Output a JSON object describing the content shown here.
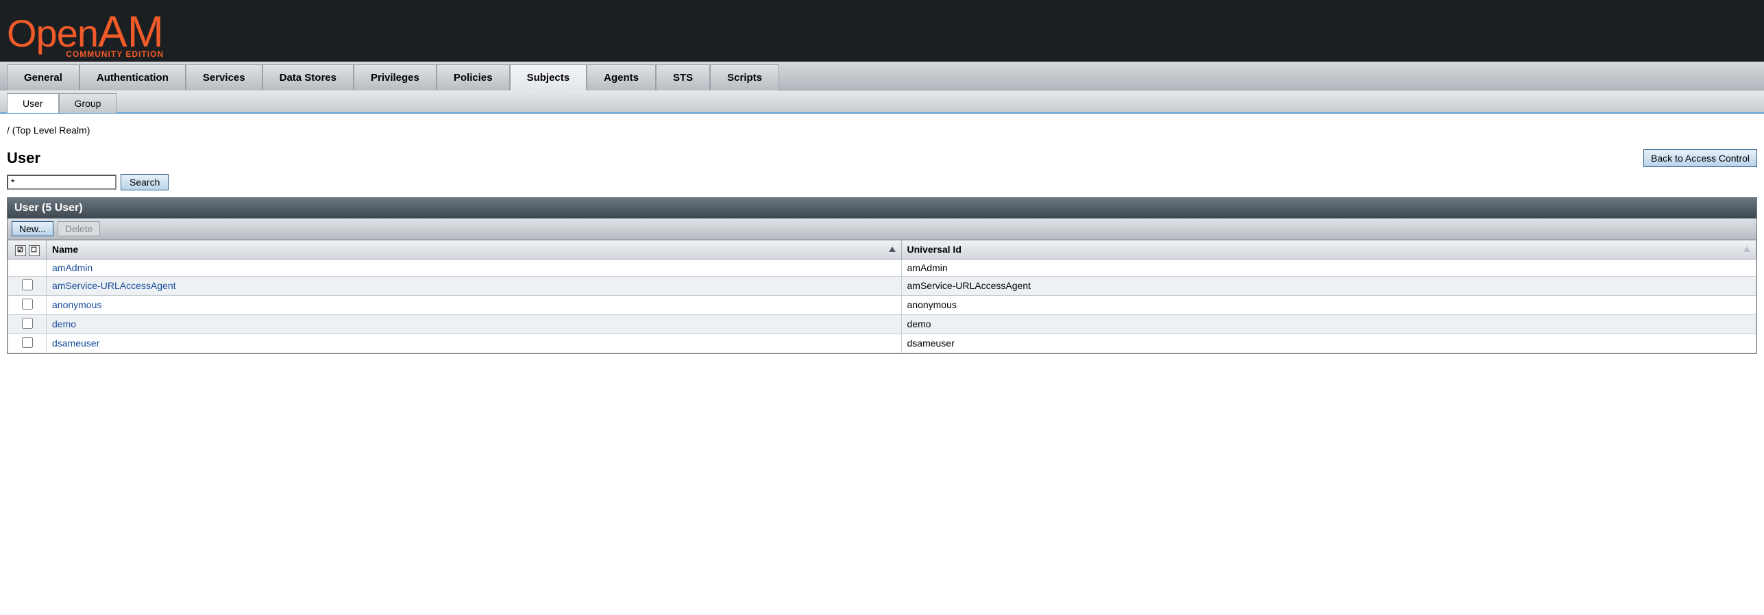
{
  "logo": {
    "open": "Open",
    "am": "AM",
    "sub": "COMMUNITY EDITION"
  },
  "tabs": [
    {
      "label": "General",
      "active": false
    },
    {
      "label": "Authentication",
      "active": false
    },
    {
      "label": "Services",
      "active": false
    },
    {
      "label": "Data Stores",
      "active": false
    },
    {
      "label": "Privileges",
      "active": false
    },
    {
      "label": "Policies",
      "active": false
    },
    {
      "label": "Subjects",
      "active": true
    },
    {
      "label": "Agents",
      "active": false
    },
    {
      "label": "STS",
      "active": false
    },
    {
      "label": "Scripts",
      "active": false
    }
  ],
  "subtabs": [
    {
      "label": "User",
      "active": true
    },
    {
      "label": "Group",
      "active": false
    }
  ],
  "breadcrumb": "/ (Top Level Realm)",
  "page_title": "User",
  "back_button": "Back to Access Control",
  "search": {
    "value": "*",
    "button": "Search"
  },
  "panel": {
    "title": "User (5 User)",
    "new_button": "New...",
    "delete_button": "Delete"
  },
  "columns": {
    "name": "Name",
    "universal_id": "Universal Id"
  },
  "rows": [
    {
      "name": "amAdmin",
      "universal_id": "amAdmin",
      "checkbox": false
    },
    {
      "name": "amService-URLAccessAgent",
      "universal_id": "amService-URLAccessAgent",
      "checkbox": true
    },
    {
      "name": "anonymous",
      "universal_id": "anonymous",
      "checkbox": true
    },
    {
      "name": "demo",
      "universal_id": "demo",
      "checkbox": true
    },
    {
      "name": "dsameuser",
      "universal_id": "dsameuser",
      "checkbox": true
    }
  ]
}
